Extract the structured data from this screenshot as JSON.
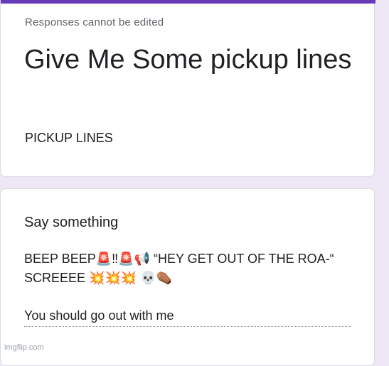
{
  "colors": {
    "accent": "#673ab7",
    "background": "#ede7f6",
    "card": "#ffffff"
  },
  "form": {
    "notice": "Responses cannot be edited",
    "title": "Give Me Some pickup lines",
    "description": "PICKUP LINES"
  },
  "question": {
    "title": "Say something",
    "answer_lines": [
      "BEEP BEEP🚨‼🚨📢 “HEY GET OUT OF THE ROA-“",
      "SCREEEE 💥💥💥 💀⚰️",
      "You should go out with me"
    ]
  },
  "watermark": "imgflip.com"
}
